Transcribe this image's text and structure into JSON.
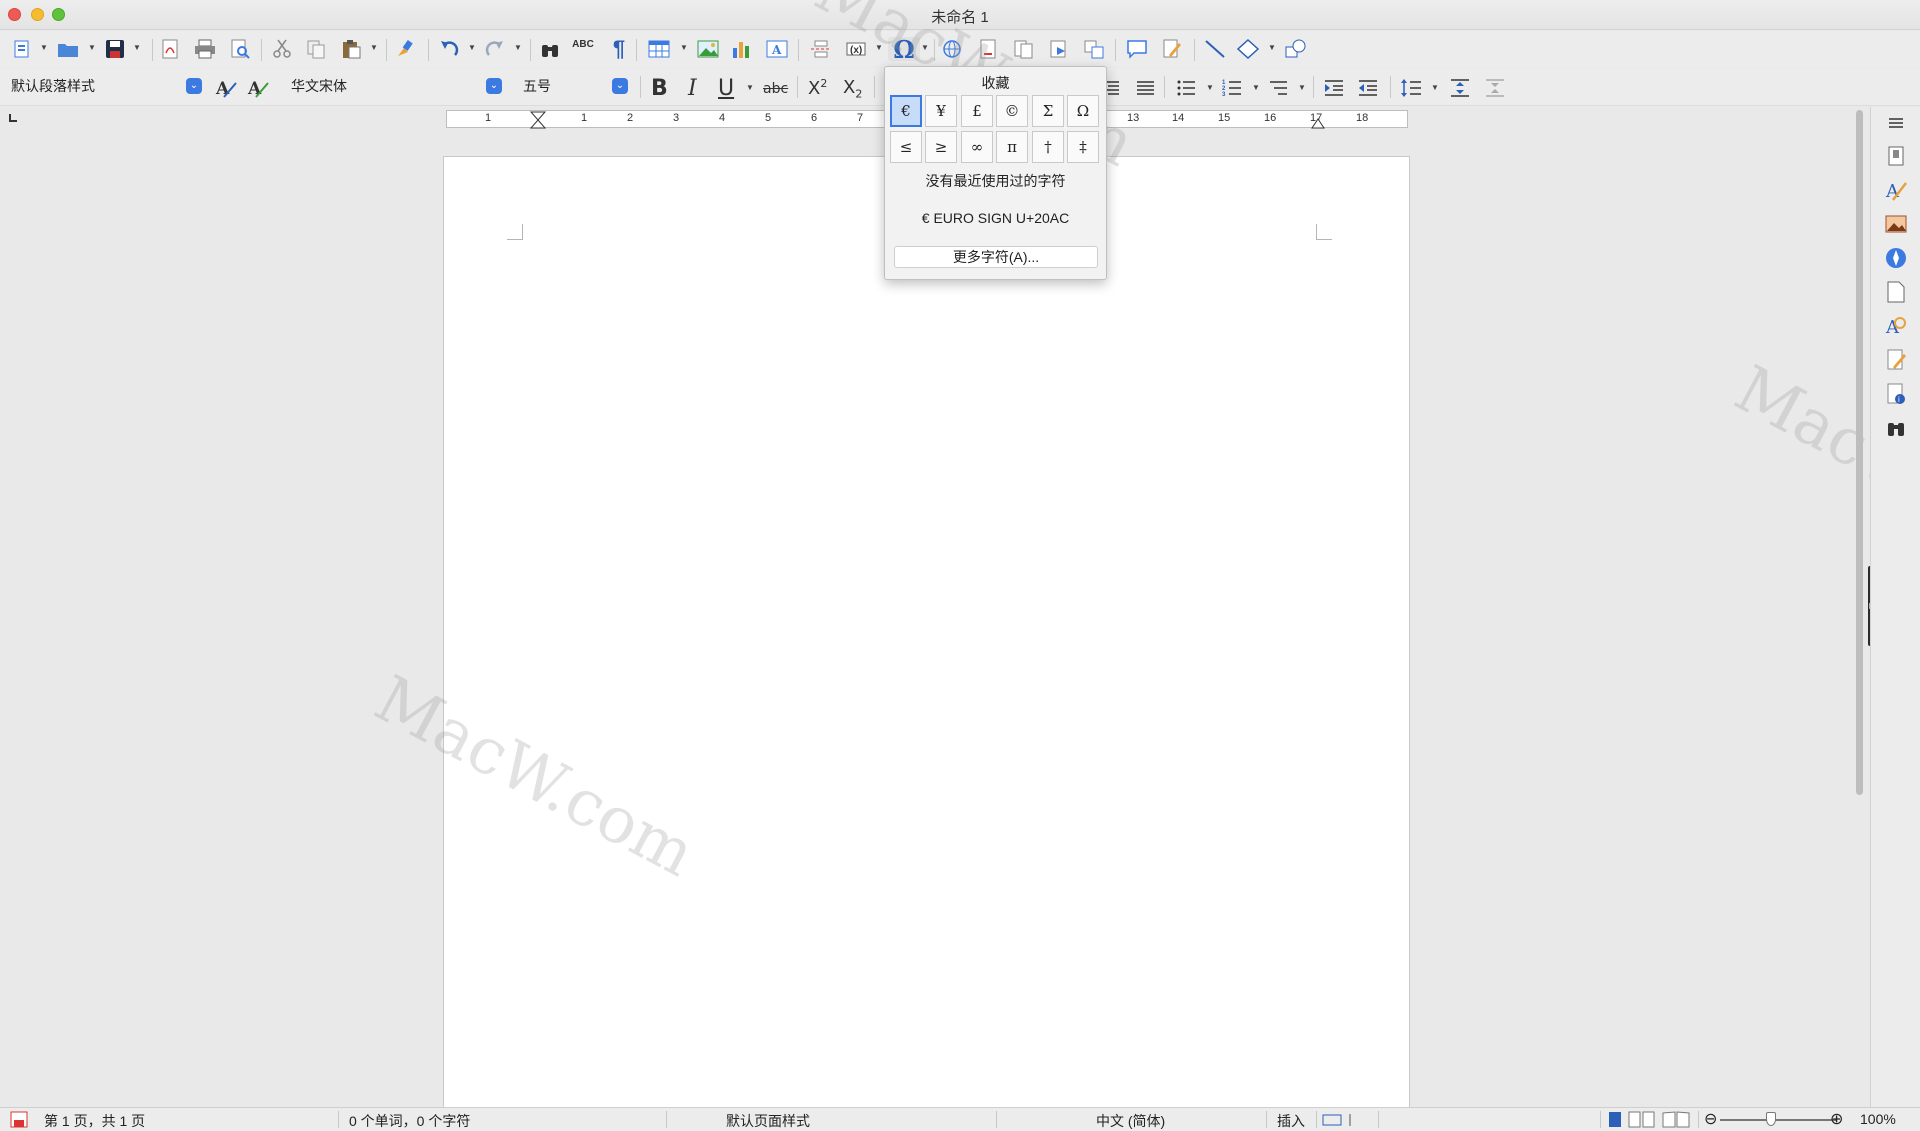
{
  "window": {
    "title": "未命名 1"
  },
  "formatting": {
    "paragraph_style": "默认段落样式",
    "font_name": "华文宋体",
    "font_size": "五号",
    "strikethrough_label": "abc"
  },
  "toolbar": {
    "spellcheck_label": "ABC"
  },
  "ruler": {
    "labels": [
      "1",
      "1",
      "2",
      "3",
      "4",
      "5",
      "6",
      "7",
      "13",
      "14",
      "15",
      "16",
      "17",
      "18"
    ]
  },
  "special_chars": {
    "title": "收藏",
    "row1": [
      "€",
      "¥",
      "£",
      "©",
      "Σ",
      "Ω"
    ],
    "row2": [
      "≤",
      "≥",
      "∞",
      "π",
      "†",
      "‡"
    ],
    "no_recent": "没有最近使用过的字符",
    "hovered_char": "€ EURO SIGN U+20AC",
    "more_button": "更多字符(A)..."
  },
  "statusbar": {
    "page_info": "第 1 页，共 1 页",
    "word_count": "0 个单词，0 个字符",
    "page_style": "默认页面样式",
    "language": "中文 (简体)",
    "insert_mode": "插入",
    "zoom": "100%"
  },
  "watermark": {
    "text": "MacW.com"
  },
  "colors": {
    "accent": "#3b7ae0",
    "toolbar_bg": "#ececec",
    "page_bg": "#ffffff"
  }
}
